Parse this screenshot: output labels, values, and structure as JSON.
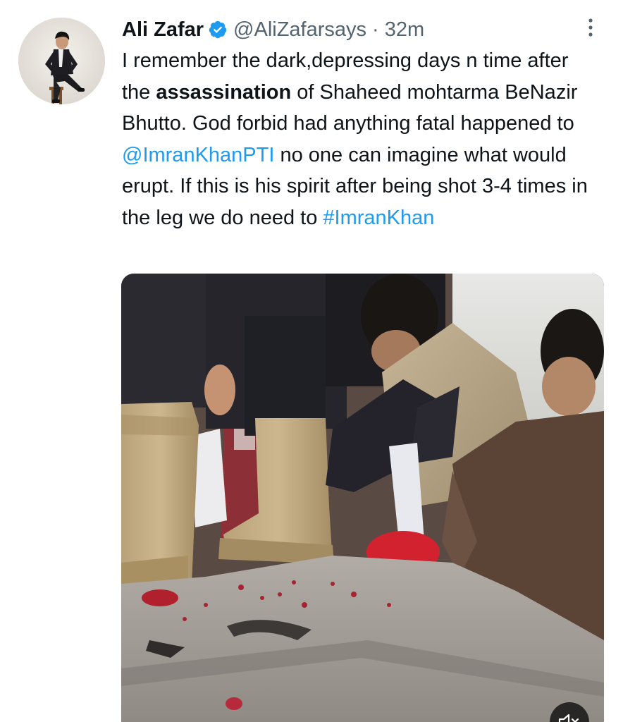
{
  "tweet": {
    "display_name": "Ali Zafar",
    "handle": "@AliZafarsays",
    "separator": "·",
    "time": "32m",
    "verified": true,
    "text": {
      "part1": "I remember the dark,depressing days n time after the ",
      "bold": "assassination",
      "part2": " of Shaheed mohtarma BeNazir Bhutto. God forbid had anything fatal happened to ",
      "mention": "@ImranKhanPTI",
      "part3": " no one can imagine what would erupt. If this is his spirit after being shot 3-4 times in the leg we do need to ",
      "hashtag": "#ImranKhan"
    },
    "media": {
      "kind": "video",
      "muted": true
    }
  },
  "colors": {
    "text": "#0f1419",
    "secondary": "#536471",
    "link": "#1d9bf0",
    "verified": "#1d9bf0"
  },
  "icons": [
    "verified-badge-icon",
    "more-options-icon",
    "volume-muted-icon"
  ]
}
